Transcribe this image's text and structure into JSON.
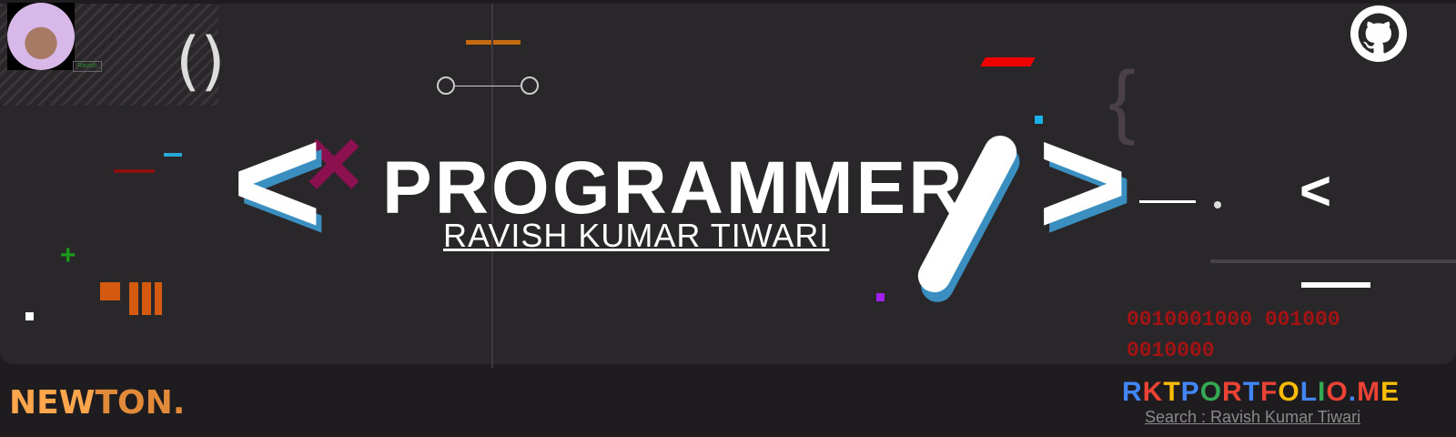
{
  "banner": {
    "tag": "Ravish",
    "title": "PROGRAMMER",
    "subtitle": "RAVISH KUMAR TIWARI",
    "open_tag": "<",
    "close_tag": ">",
    "left_arrow": "<",
    "brackets": "()",
    "binary_line1": "0010001000 001000",
    "binary_line2": "0010000",
    "brand_new": "NEW",
    "brand_ton": "TON.",
    "site": {
      "text": "RKTPORTFOLIO.ME",
      "letters": [
        [
          "R",
          "#4285f4"
        ],
        [
          "K",
          "#ea4335"
        ],
        [
          "T",
          "#fbbc05"
        ],
        [
          "P",
          "#4285f4"
        ],
        [
          "O",
          "#34a853"
        ],
        [
          "R",
          "#ea4335"
        ],
        [
          "T",
          "#4285f4"
        ],
        [
          "F",
          "#ea4335"
        ],
        [
          "O",
          "#fbbc05"
        ],
        [
          "L",
          "#4285f4"
        ],
        [
          "I",
          "#34a853"
        ],
        [
          "O",
          "#ea4335"
        ],
        [
          ".",
          "#4285f4"
        ],
        [
          "M",
          "#ea4335"
        ],
        [
          "E",
          "#fbbc05"
        ]
      ]
    },
    "search": "Search : Ravish Kumar Tiwari"
  },
  "colors": {
    "bg": "#29272a",
    "accent_blue": "#3a8fc0",
    "binary": "#a31313",
    "newton": "#ffa64d"
  }
}
